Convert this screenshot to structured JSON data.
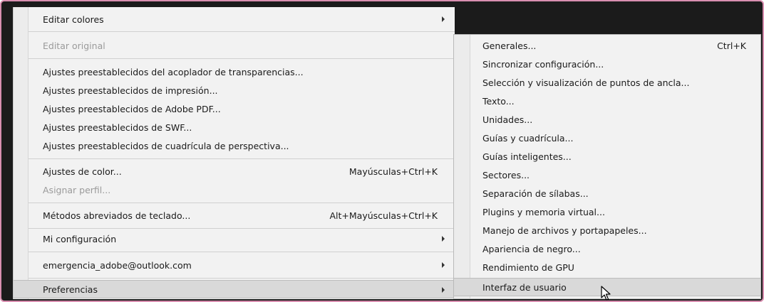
{
  "main_menu": {
    "items": [
      {
        "label": "Editar colores",
        "submenu": true
      },
      {
        "label": "Editar original",
        "disabled": true
      },
      {
        "label": "Ajustes preestablecidos del acoplador de transparencias..."
      },
      {
        "label": "Ajustes preestablecidos de impresión..."
      },
      {
        "label": "Ajustes preestablecidos de Adobe PDF..."
      },
      {
        "label": "Ajustes preestablecidos de SWF..."
      },
      {
        "label": "Ajustes preestablecidos de cuadrícula de perspectiva..."
      },
      {
        "label": "Ajustes de color...",
        "shortcut": "Mayúsculas+Ctrl+K"
      },
      {
        "label": "Asignar perfil...",
        "disabled": true
      },
      {
        "label": "Métodos abreviados de teclado...",
        "shortcut": "Alt+Mayúsculas+Ctrl+K"
      },
      {
        "label": "Mi configuración",
        "submenu": true
      },
      {
        "label": "emergencia_adobe@outlook.com",
        "submenu": true
      },
      {
        "label": "Preferencias",
        "submenu": true,
        "highlighted": true
      }
    ]
  },
  "preferences_submenu": {
    "items": [
      {
        "label": "Generales...",
        "shortcut": "Ctrl+K"
      },
      {
        "label": "Sincronizar configuración..."
      },
      {
        "label": "Selección y visualización de puntos de ancla..."
      },
      {
        "label": "Texto..."
      },
      {
        "label": "Unidades..."
      },
      {
        "label": "Guías y cuadrícula..."
      },
      {
        "label": "Guías inteligentes..."
      },
      {
        "label": "Sectores..."
      },
      {
        "label": "Separación de sílabas..."
      },
      {
        "label": "Plugins y memoria virtual..."
      },
      {
        "label": "Manejo de archivos y portapapeles..."
      },
      {
        "label": "Apariencia de negro..."
      },
      {
        "label": "Rendimiento de GPU"
      },
      {
        "label": "Interfaz de usuario",
        "highlighted": true
      }
    ]
  },
  "cursor_icon": "arrow-pointer-icon"
}
